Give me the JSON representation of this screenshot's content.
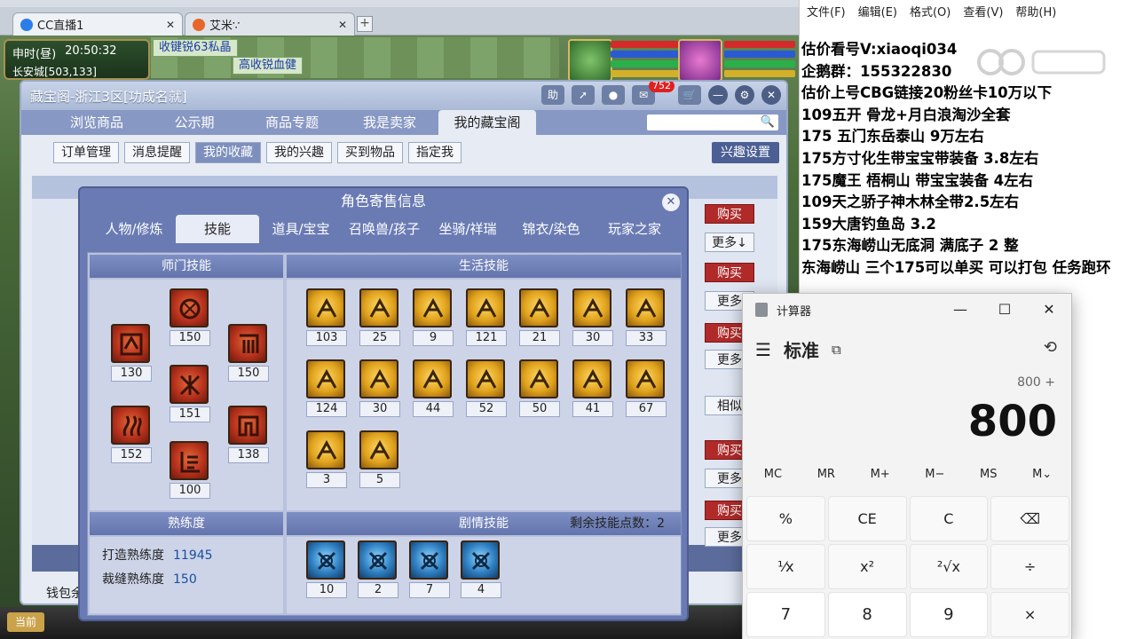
{
  "browser": {
    "tabs": [
      {
        "label": "CC直播1"
      },
      {
        "label": "艾米∵"
      }
    ],
    "new_tab": "+"
  },
  "game": {
    "clock_period": "申时(昼)",
    "clock_time": "20:50:32",
    "location": "长安城[503,133]",
    "banner_1": "收键锐63私晶",
    "banner_2": "高收锐血健",
    "bottom_button": "当前"
  },
  "cbg": {
    "title": "藏宝阁-浙江3区[功成名就]",
    "help_label": "助",
    "msg_count": "752",
    "nav": [
      {
        "label": "浏览商品"
      },
      {
        "label": "公示期"
      },
      {
        "label": "商品专题"
      },
      {
        "label": "我是卖家"
      },
      {
        "label": "我的藏宝阁"
      }
    ],
    "subnav": [
      {
        "label": "订单管理"
      },
      {
        "label": "消息提醒"
      },
      {
        "label": "我的收藏"
      },
      {
        "label": "我的兴趣"
      },
      {
        "label": "买到物品"
      },
      {
        "label": "指定我"
      }
    ],
    "interest_settings": "兴趣设置",
    "side_buttons": {
      "buy": "购买",
      "more": "更多",
      "more_down": "更多↓",
      "similar": "相似"
    },
    "wallet": "钱包余"
  },
  "dialog": {
    "title": "角色寄售信息",
    "tabs": [
      {
        "label": "人物/修炼"
      },
      {
        "label": "技能"
      },
      {
        "label": "道具/宝宝"
      },
      {
        "label": "召唤兽/孩子"
      },
      {
        "label": "坐骑/祥瑞"
      },
      {
        "label": "锦衣/染色"
      },
      {
        "label": "玩家之家"
      }
    ],
    "school_skills_title": "师门技能",
    "school_skills": [
      "130",
      "150",
      "150",
      "151",
      "152",
      "138",
      "100"
    ],
    "life_skills_title": "生活技能",
    "life_skills": [
      "103",
      "25",
      "9",
      "121",
      "21",
      "30",
      "33",
      "124",
      "30",
      "44",
      "52",
      "50",
      "41",
      "67",
      "3",
      "5"
    ],
    "proficiency_title": "熟练度",
    "proficiency": [
      {
        "label": "打造熟练度",
        "value": "11945"
      },
      {
        "label": "裁缝熟练度",
        "value": "150"
      }
    ],
    "story_skills_title": "剧情技能",
    "remaining_points_label": "剩余技能点数：",
    "remaining_points": "2",
    "story_skills": [
      "10",
      "2",
      "7",
      "4"
    ]
  },
  "notepad": {
    "menu": [
      {
        "label": "文件(F)"
      },
      {
        "label": "编辑(E)"
      },
      {
        "label": "格式(O)"
      },
      {
        "label": "查看(V)"
      },
      {
        "label": "帮助(H)"
      }
    ],
    "lines": [
      "估价看号V:xiaoqi034",
      "企鹅群：155322830",
      "估价上号CBG链接20粉丝卡10万以下",
      "109五开 骨龙+月白浪淘沙全套",
      "175 五门东岳泰山  9万左右",
      "175方寸化生带宝宝带装备  3.8左右",
      "175魔王 梧桐山  带宝宝装备 4左右",
      "109天之骄子神木林全带2.5左右",
      "159大唐钓鱼岛  3.2",
      "175东海崂山无底洞  满底子  2 整",
      "东海崂山 三个175可以单买 可以打包 任务跑环"
    ]
  },
  "calculator": {
    "app_name": "计算器",
    "mode": "标准",
    "expression": "800 +",
    "display": "800",
    "memory": [
      "MC",
      "MR",
      "M+",
      "M−",
      "MS",
      "M⌄"
    ],
    "keys": [
      "%",
      "CE",
      "C",
      "⌫",
      "¹⁄x",
      "x²",
      "²√x",
      "÷",
      "7",
      "8",
      "9",
      "×"
    ],
    "win_min": "—",
    "win_max": "☐",
    "win_close": "✕"
  }
}
